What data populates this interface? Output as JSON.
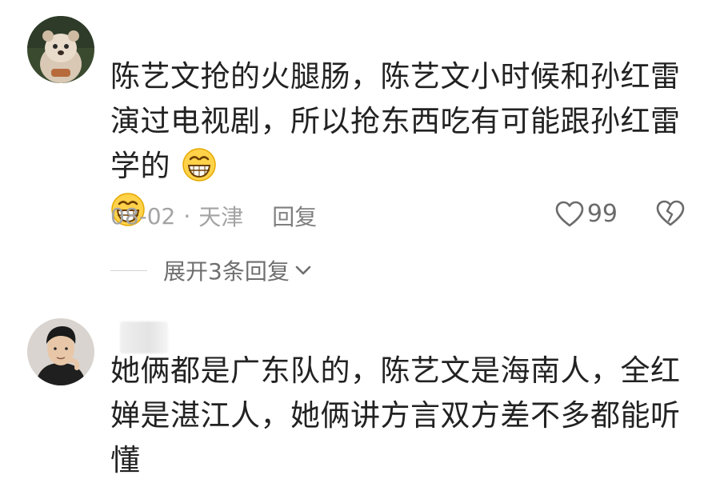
{
  "comments": [
    {
      "avatar": "bear-avatar",
      "text_main": "陈艺文抢的火腿肠，陈艺文小时候和孙红雷演过电视剧，所以抢东西吃有可能跟孙红雷学的",
      "emoji": [
        "grin-emoji",
        "grin-emoji"
      ],
      "date": "08-02",
      "separator": "·",
      "location": "天津",
      "reply_label": "回复",
      "likes": "99",
      "expand_label": "展开3条回复"
    },
    {
      "avatar": "man-avatar",
      "text": "她俩都是广东队的，陈艺文是海南人，全红婵是湛江人，她俩讲方言双方差不多都能听懂"
    }
  ],
  "colors": {
    "text": "#222222",
    "meta": "#a3a3a3",
    "reply": "#7f7f7f",
    "icon": "#6b6b6b"
  }
}
